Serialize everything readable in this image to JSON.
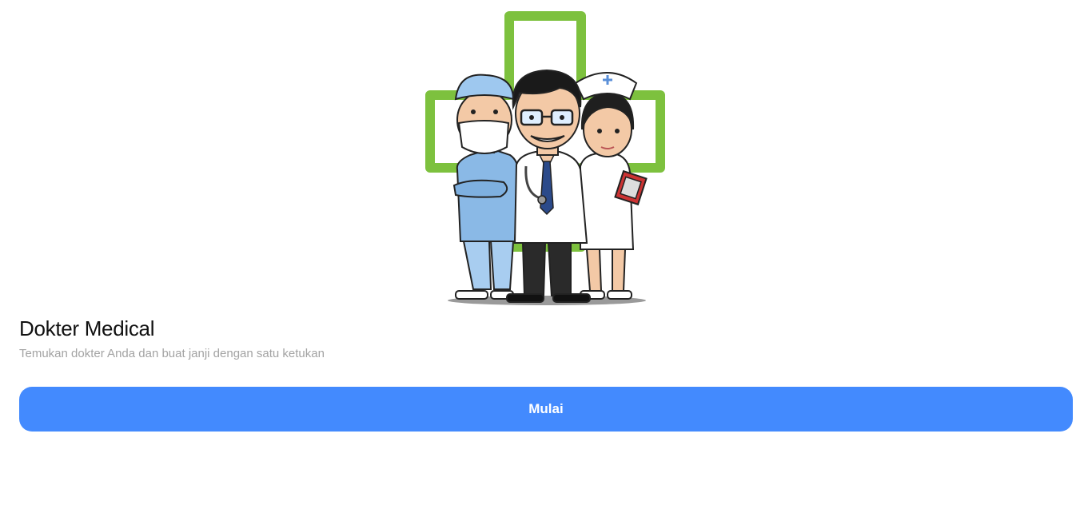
{
  "hero": {
    "illustration": "doctors-illustration",
    "cross_color": "#7dc13e"
  },
  "onboarding": {
    "title": "Dokter Medical",
    "subtitle": "Temukan dokter Anda dan buat janji dengan satu ketukan",
    "start_label": "Mulai"
  },
  "colors": {
    "accent": "#438afe"
  }
}
